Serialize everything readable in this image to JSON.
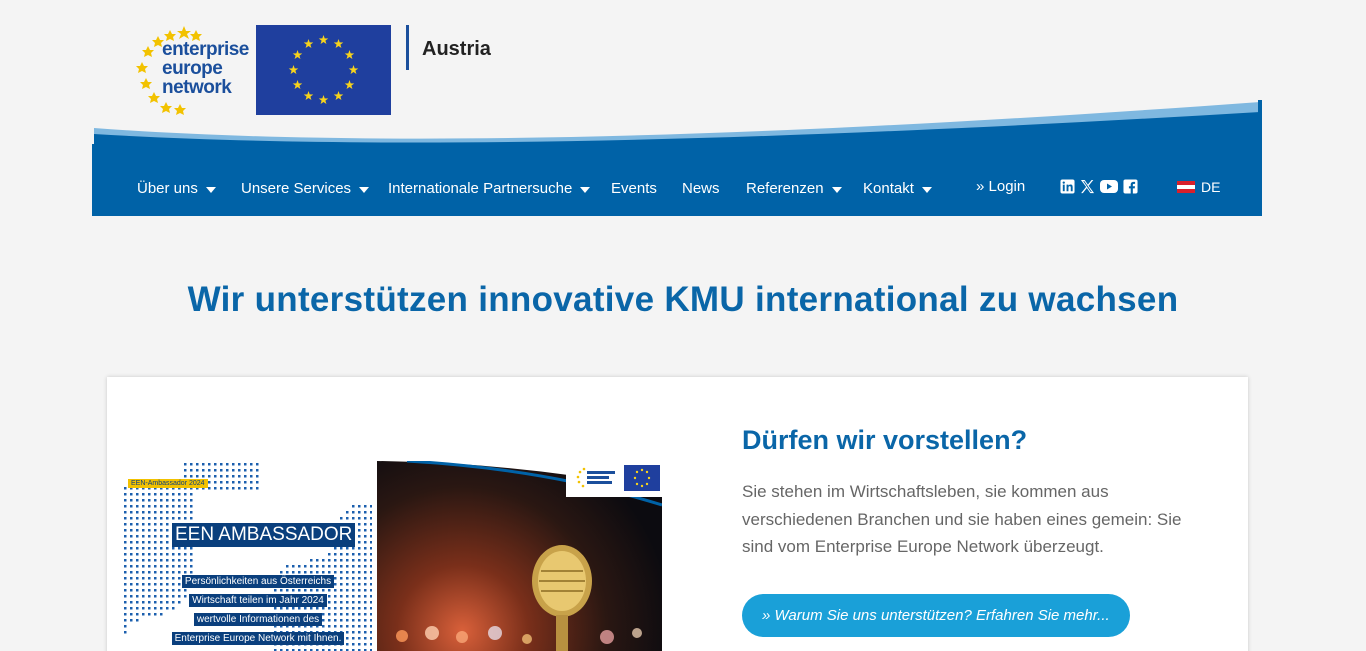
{
  "header": {
    "logo_lines": [
      "enterprise",
      "europe",
      "network"
    ],
    "country": "Austria"
  },
  "nav": {
    "items": [
      {
        "label": "Über uns",
        "dropdown": true
      },
      {
        "label": "Unsere Services",
        "dropdown": true
      },
      {
        "label": "Internationale Partnersuche",
        "dropdown": true
      },
      {
        "label": "Events",
        "dropdown": false
      },
      {
        "label": "News",
        "dropdown": false
      },
      {
        "label": "Referenzen",
        "dropdown": true
      },
      {
        "label": "Kontakt",
        "dropdown": true
      }
    ],
    "login": "» Login",
    "social_icons": [
      "linkedin-icon",
      "x-icon",
      "youtube-icon",
      "facebook-icon"
    ],
    "language": "DE"
  },
  "hero": {
    "title": "Wir unterstützen innovative KMU international zu wachsen"
  },
  "card": {
    "image": {
      "badge": "EEN-Ambassador 2024",
      "heading": "EEN AMBASSADOR",
      "lines": [
        "Persönlichkeiten aus Österreichs",
        "Wirtschaft teilen im Jahr 2024",
        "wertvolle Informationen des",
        "Enterprise Europe Network mit Ihnen."
      ]
    },
    "title": "Dürfen wir vorstellen?",
    "text": "Sie stehen im Wirtschaftsleben, sie kommen aus verschiedenen Branchen und sie haben eines gemein: Sie sind vom Enterprise Europe Network überzeugt.",
    "cta": "» Warum Sie uns unterstützen? Erfahren Sie mehr..."
  },
  "colors": {
    "brand_blue": "#0062a7",
    "title_blue": "#0a66a8",
    "cta_blue": "#1aa0d8",
    "eu_blue": "#1f3f9e",
    "star_yellow": "#f7d31c"
  }
}
